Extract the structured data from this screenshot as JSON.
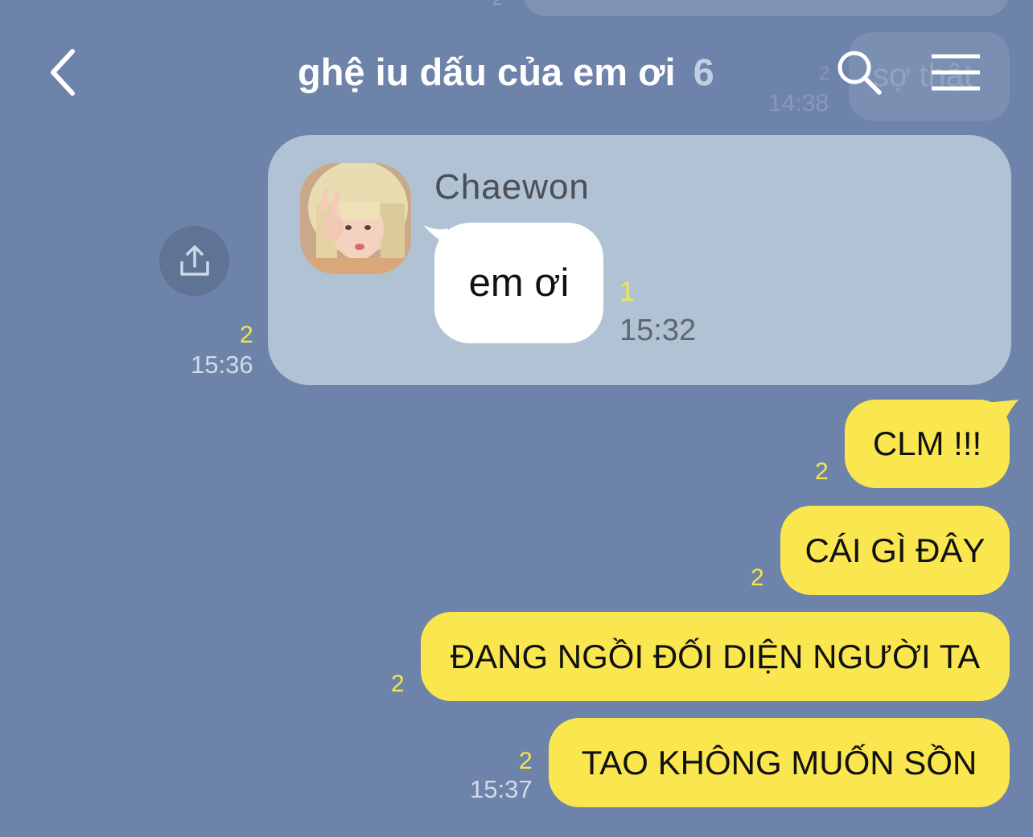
{
  "header": {
    "title": "ghệ iu dấu của em ơi",
    "member_count": "6"
  },
  "background_fragments": {
    "bubble_text": "sợ thật",
    "unread": "2",
    "time": "14:38",
    "top_unread": "2"
  },
  "reply_card": {
    "sender": "Chaewon",
    "message": "em ơi",
    "message_unread": "1",
    "message_time": "15:32",
    "unread": "2",
    "time": "15:36"
  },
  "messages": [
    {
      "text": "CLM !!!",
      "unread": "2"
    },
    {
      "text": "CÁI GÌ ĐÂY",
      "unread": "2"
    },
    {
      "text": "ĐANG NGỒI ĐỐI DIỆN NGƯỜI TA",
      "unread": "2"
    },
    {
      "text": "TAO KHÔNG MUỐN SỒN",
      "unread": "2",
      "time": "15:37"
    }
  ],
  "colors": {
    "background": "#6e83a9",
    "outgoing_bubble": "#fae64f",
    "reply_card": "#b0c2d3",
    "unread_count": "#f5e64b"
  },
  "icons": [
    "back-arrow-icon",
    "search-icon",
    "menu-icon",
    "share-icon"
  ]
}
